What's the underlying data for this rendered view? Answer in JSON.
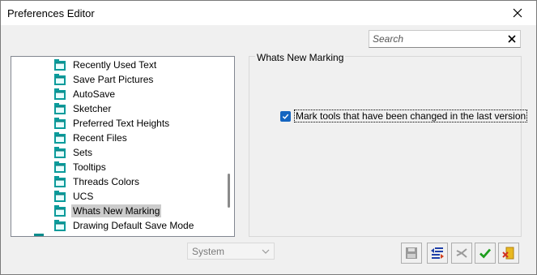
{
  "window": {
    "title": "Preferences Editor"
  },
  "search": {
    "placeholder": "Search",
    "value": ""
  },
  "tree": {
    "items": [
      {
        "label": "Recently Used Text",
        "selected": false
      },
      {
        "label": "Save Part Pictures",
        "selected": false
      },
      {
        "label": "AutoSave",
        "selected": false
      },
      {
        "label": "Sketcher",
        "selected": false
      },
      {
        "label": "Preferred Text Heights",
        "selected": false
      },
      {
        "label": "Recent Files",
        "selected": false
      },
      {
        "label": "Sets",
        "selected": false
      },
      {
        "label": "Tooltips",
        "selected": false
      },
      {
        "label": "Threads Colors",
        "selected": false
      },
      {
        "label": "UCS",
        "selected": false
      },
      {
        "label": "Whats New Marking",
        "selected": true
      },
      {
        "label": "Drawing Default Save Mode",
        "selected": false
      }
    ]
  },
  "panel": {
    "group_title": "Whats New Marking",
    "checkbox_label": "Mark tools that have been changed in the last version",
    "checkbox_checked": true
  },
  "footer": {
    "scope_value": "System",
    "buttons": [
      {
        "name": "save-button",
        "icon": "floppy-disk-icon",
        "enabled": false
      },
      {
        "name": "compare-button",
        "icon": "compare-list-icon",
        "enabled": true
      },
      {
        "name": "reset-button",
        "icon": "reset-arrows-icon",
        "enabled": false
      },
      {
        "name": "ok-button",
        "icon": "green-check-icon",
        "enabled": true
      },
      {
        "name": "exit-button",
        "icon": "exit-door-icon",
        "enabled": true
      }
    ]
  },
  "colors": {
    "accent": "#1565c0",
    "folder_icon": "#0a9b9b",
    "ok_green": "#1e9e1e",
    "selection": "#cccccc"
  }
}
